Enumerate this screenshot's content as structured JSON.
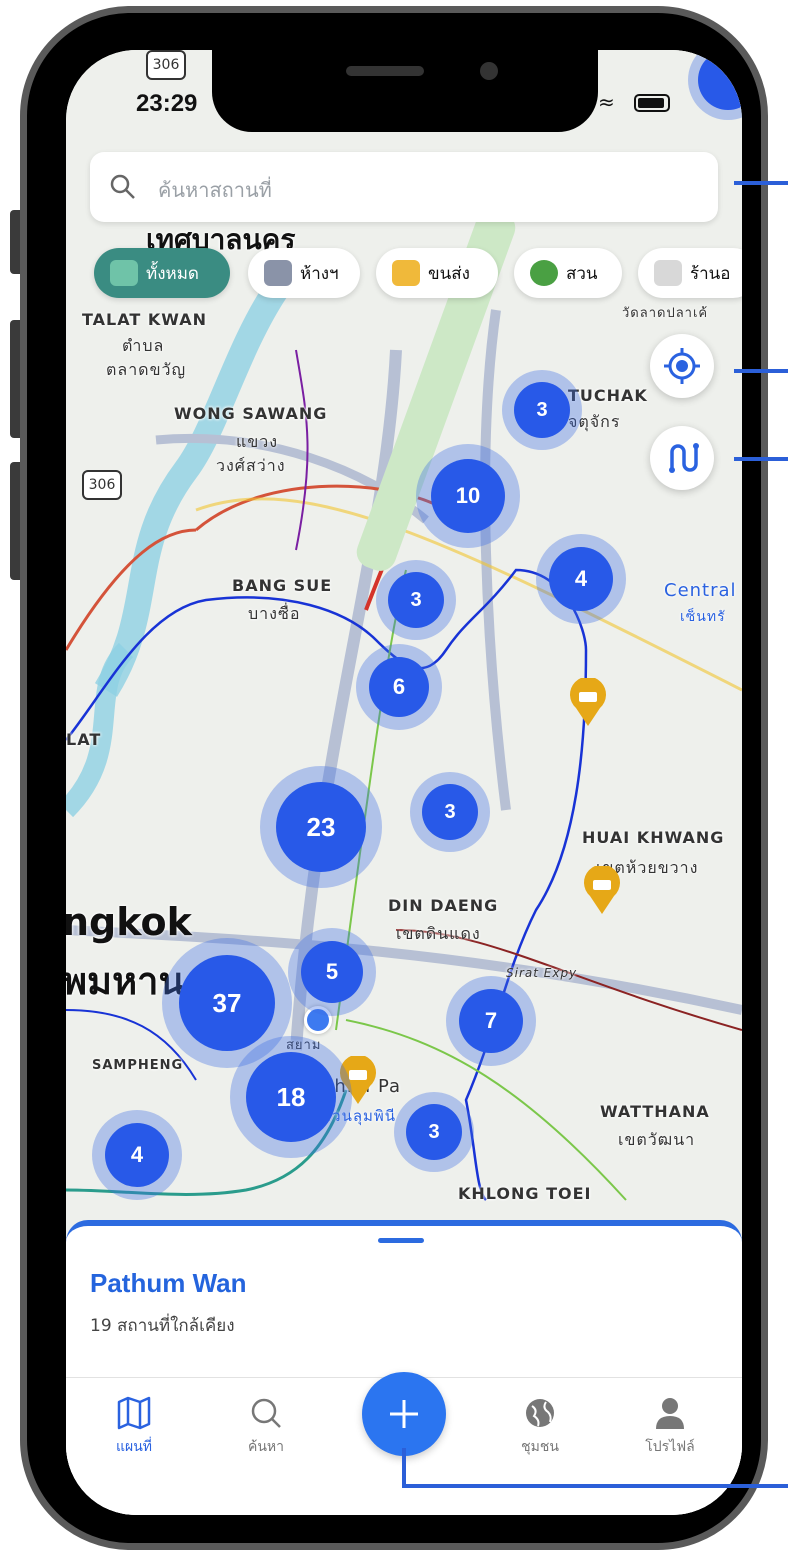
{
  "status_bar": {
    "time": "23:29"
  },
  "search": {
    "placeholder": "ค้นหาสถานที่"
  },
  "categories": [
    {
      "label": "ทั้งหมด",
      "active": true
    },
    {
      "label": "ห้างฯ",
      "active": false
    },
    {
      "label": "ขนส่ง",
      "active": false
    },
    {
      "label": "สวน",
      "active": false
    },
    {
      "label": "ร้านอ",
      "active": false
    }
  ],
  "map": {
    "labels": {
      "thesaban": "เทศบาลนคร",
      "talat_kwan": "TALAT KWAN",
      "talat_kwan_th1": "ตำบล",
      "talat_kwan_th2": "ตลาดขวัญ",
      "wong_sawang": "WONG SAWANG",
      "wong_sawang_th1": "แขวง",
      "wong_sawang_th2": "วงศ์สว่าง",
      "tuchak": "TUCHAK",
      "tuchak_th": "จตุจักร",
      "wat": "วัดลาดปลาเค้",
      "bang_sue": "BANG SUE",
      "bang_sue_th": "บางซื่อ",
      "central": "Central",
      "central_th": "เซ็นทรั",
      "lat": "LAT",
      "huai_khwang": "HUAI KHWANG",
      "huai_khwang_th": "เขตห้วยขวาง",
      "din_daeng": "DIN DAENG",
      "din_daeng_th": "เขตดินแดง",
      "bangkok": "ngkok",
      "bangkok_th": "พมหาน",
      "sirat_expy": "Sirat Expy",
      "sampheng": "SAMPHENG",
      "siam": "สยาม",
      "lumphini": "phini Pa",
      "lumphini_th": "สวนลุมพินี",
      "watthana": "WATTHANA",
      "watthana_th": "เขตวัฒนา",
      "khlong_toei": "KHLONG TOEI",
      "route_306a": "306",
      "route_306b": "306"
    },
    "clusters": [
      "3",
      "10",
      "4",
      "3",
      "6",
      "23",
      "3",
      "5",
      "37",
      "7",
      "18",
      "3",
      "4"
    ]
  },
  "sheet": {
    "title": "Pathum Wan",
    "subtitle": "19 สถานที่ใกล้เคียง"
  },
  "tabs": {
    "map": "แผนที่",
    "search": "ค้นหา",
    "community": "ชุมชน",
    "profile": "โปรไฟล์"
  },
  "colors": {
    "accent": "#2859e8",
    "chip_active": "#3a8c82",
    "pin": "#e6a817"
  }
}
